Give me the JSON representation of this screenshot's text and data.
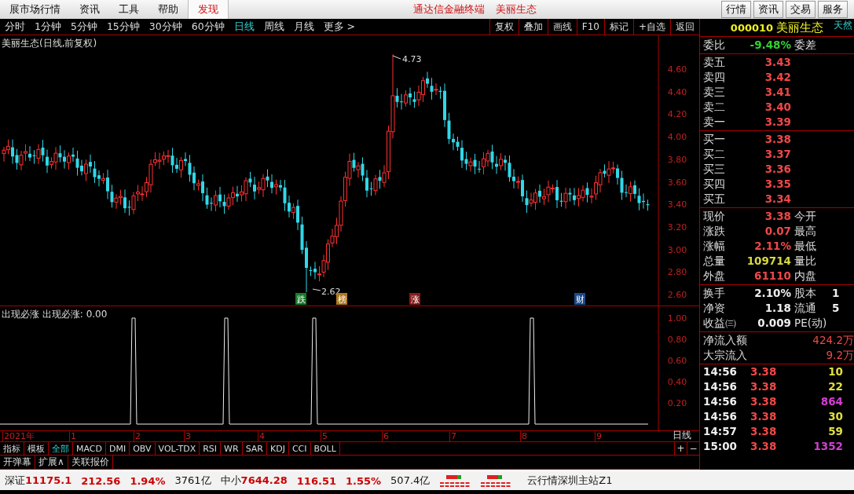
{
  "menu_bar": {
    "items": [
      {
        "label": "展市场行情",
        "selected": false
      },
      {
        "label": "资讯",
        "selected": false
      },
      {
        "label": "工具",
        "selected": false
      },
      {
        "label": "帮助",
        "selected": false
      },
      {
        "label": "发现",
        "selected": true
      }
    ],
    "title": [
      "通达信金融终端",
      "美丽生态"
    ],
    "buttons": [
      "行情",
      "资讯",
      "交易",
      "服务"
    ]
  },
  "periods": [
    {
      "label": "分时",
      "selected": false
    },
    {
      "label": "1分钟",
      "selected": false
    },
    {
      "label": "5分钟",
      "selected": false
    },
    {
      "label": "15分钟",
      "selected": false
    },
    {
      "label": "30分钟",
      "selected": false
    },
    {
      "label": "60分钟",
      "selected": false
    },
    {
      "label": "日线",
      "selected": true
    },
    {
      "label": "周线",
      "selected": false
    },
    {
      "label": "月线",
      "selected": false
    },
    {
      "label": "更多 >",
      "selected": false
    }
  ],
  "chart_tools": [
    "复权",
    "叠加",
    "画线",
    "F10",
    "标记",
    "+自选",
    "返回"
  ],
  "main_chart": {
    "title": "美丽生态(日线,前复权)",
    "yaxis": [
      "4.60",
      "4.40",
      "4.20",
      "4.00",
      "3.80",
      "3.60",
      "3.40",
      "3.20",
      "3.00",
      "2.80",
      "2.60"
    ],
    "high_label": "4.73",
    "low_label": "2.62",
    "events": [
      {
        "label": "跌",
        "color": "#1a7a2a"
      },
      {
        "label": "榜",
        "color": "#b07a20"
      },
      {
        "label": "涨",
        "color": "#8a1a1a"
      },
      {
        "label": "财",
        "color": "#1a4a8a"
      }
    ]
  },
  "indicator": {
    "title": "出现必涨 出现必涨: 0.00",
    "yaxis": [
      "1.00",
      "0.80",
      "0.60",
      "0.40",
      "0.20"
    ]
  },
  "date_axis": {
    "labels": [
      "2021年",
      "1",
      "2",
      "3",
      "4",
      "5",
      "6",
      "7",
      "8",
      "9"
    ],
    "period": "日线"
  },
  "indicator_tabs": [
    {
      "label": "指标",
      "selected": false
    },
    {
      "label": "模板",
      "selected": false
    },
    {
      "label": "全部",
      "selected": true
    },
    {
      "label": "MACD",
      "selected": false
    },
    {
      "label": "DMI",
      "selected": false
    },
    {
      "label": "OBV",
      "selected": false
    },
    {
      "label": "VOL-TDX",
      "selected": false
    },
    {
      "label": "RSI",
      "selected": false
    },
    {
      "label": "WR",
      "selected": false
    },
    {
      "label": "SAR",
      "selected": false
    },
    {
      "label": "KDJ",
      "selected": false
    },
    {
      "label": "CCI",
      "selected": false
    },
    {
      "label": "BOLL",
      "selected": false
    }
  ],
  "zoom_buttons": [
    "+",
    "−"
  ],
  "extra_tabs": [
    "开弹幕",
    "扩展∧",
    "关联报价"
  ],
  "quote": {
    "code": "000010",
    "name": "美丽生态",
    "tag": "天然",
    "ratio_label": "委比",
    "ratio": "-9.48%",
    "diff_label": "委差",
    "asks": [
      {
        "label": "卖五",
        "price": "3.43"
      },
      {
        "label": "卖四",
        "price": "3.42"
      },
      {
        "label": "卖三",
        "price": "3.41"
      },
      {
        "label": "卖二",
        "price": "3.40"
      },
      {
        "label": "卖一",
        "price": "3.39"
      }
    ],
    "bids": [
      {
        "label": "买一",
        "price": "3.38"
      },
      {
        "label": "买二",
        "price": "3.37"
      },
      {
        "label": "买三",
        "price": "3.36"
      },
      {
        "label": "买四",
        "price": "3.35"
      },
      {
        "label": "买五",
        "price": "3.34"
      }
    ],
    "stats": [
      {
        "label": "现价",
        "value": "3.38",
        "label2": "今开",
        "kind": "up"
      },
      {
        "label": "涨跌",
        "value": "0.07",
        "label2": "最高",
        "kind": "up"
      },
      {
        "label": "涨幅",
        "value": "2.11%",
        "label2": "最低",
        "kind": "up"
      },
      {
        "label": "总量",
        "value": "109714",
        "label2": "量比",
        "kind": "volume"
      },
      {
        "label": "外盘",
        "value": "61110",
        "label2": "内盘",
        "kind": "up"
      }
    ],
    "stats2": [
      {
        "label": "换手",
        "value": "2.10%",
        "label2": "股本",
        "value2": "1"
      },
      {
        "label": "净资",
        "value": "1.18",
        "label2": "流通",
        "value2": "5"
      },
      {
        "label": "收益㈢",
        "value": "0.009",
        "label2": "PE(动)"
      }
    ],
    "flows": [
      {
        "label": "净流入额",
        "value": "424.2万"
      },
      {
        "label": "大宗流入",
        "value": "9.2万"
      }
    ],
    "ticks": [
      {
        "time": "14:56",
        "price": "3.38",
        "volume": "10",
        "color": "#e0e040"
      },
      {
        "time": "14:56",
        "price": "3.38",
        "volume": "22",
        "color": "#e0e040"
      },
      {
        "time": "14:56",
        "price": "3.38",
        "volume": "864",
        "color": "#d040d0"
      },
      {
        "time": "14:56",
        "price": "3.38",
        "volume": "30",
        "color": "#e0e040"
      },
      {
        "time": "14:57",
        "price": "3.38",
        "volume": "59",
        "color": "#e0e040"
      },
      {
        "time": "15:00",
        "price": "3.38",
        "volume": "1352",
        "color": "#d040d0"
      }
    ]
  },
  "status_bar": {
    "indices": [
      {
        "name": "深证",
        "value": "11175.1",
        "change": "212.56",
        "pct": "1.94%",
        "amount": "3761亿"
      },
      {
        "name": "中小",
        "value": "7644.28",
        "change": "116.51",
        "pct": "1.55%",
        "amount": "507.4亿"
      }
    ],
    "server": "云行情深圳主站Z1"
  }
}
